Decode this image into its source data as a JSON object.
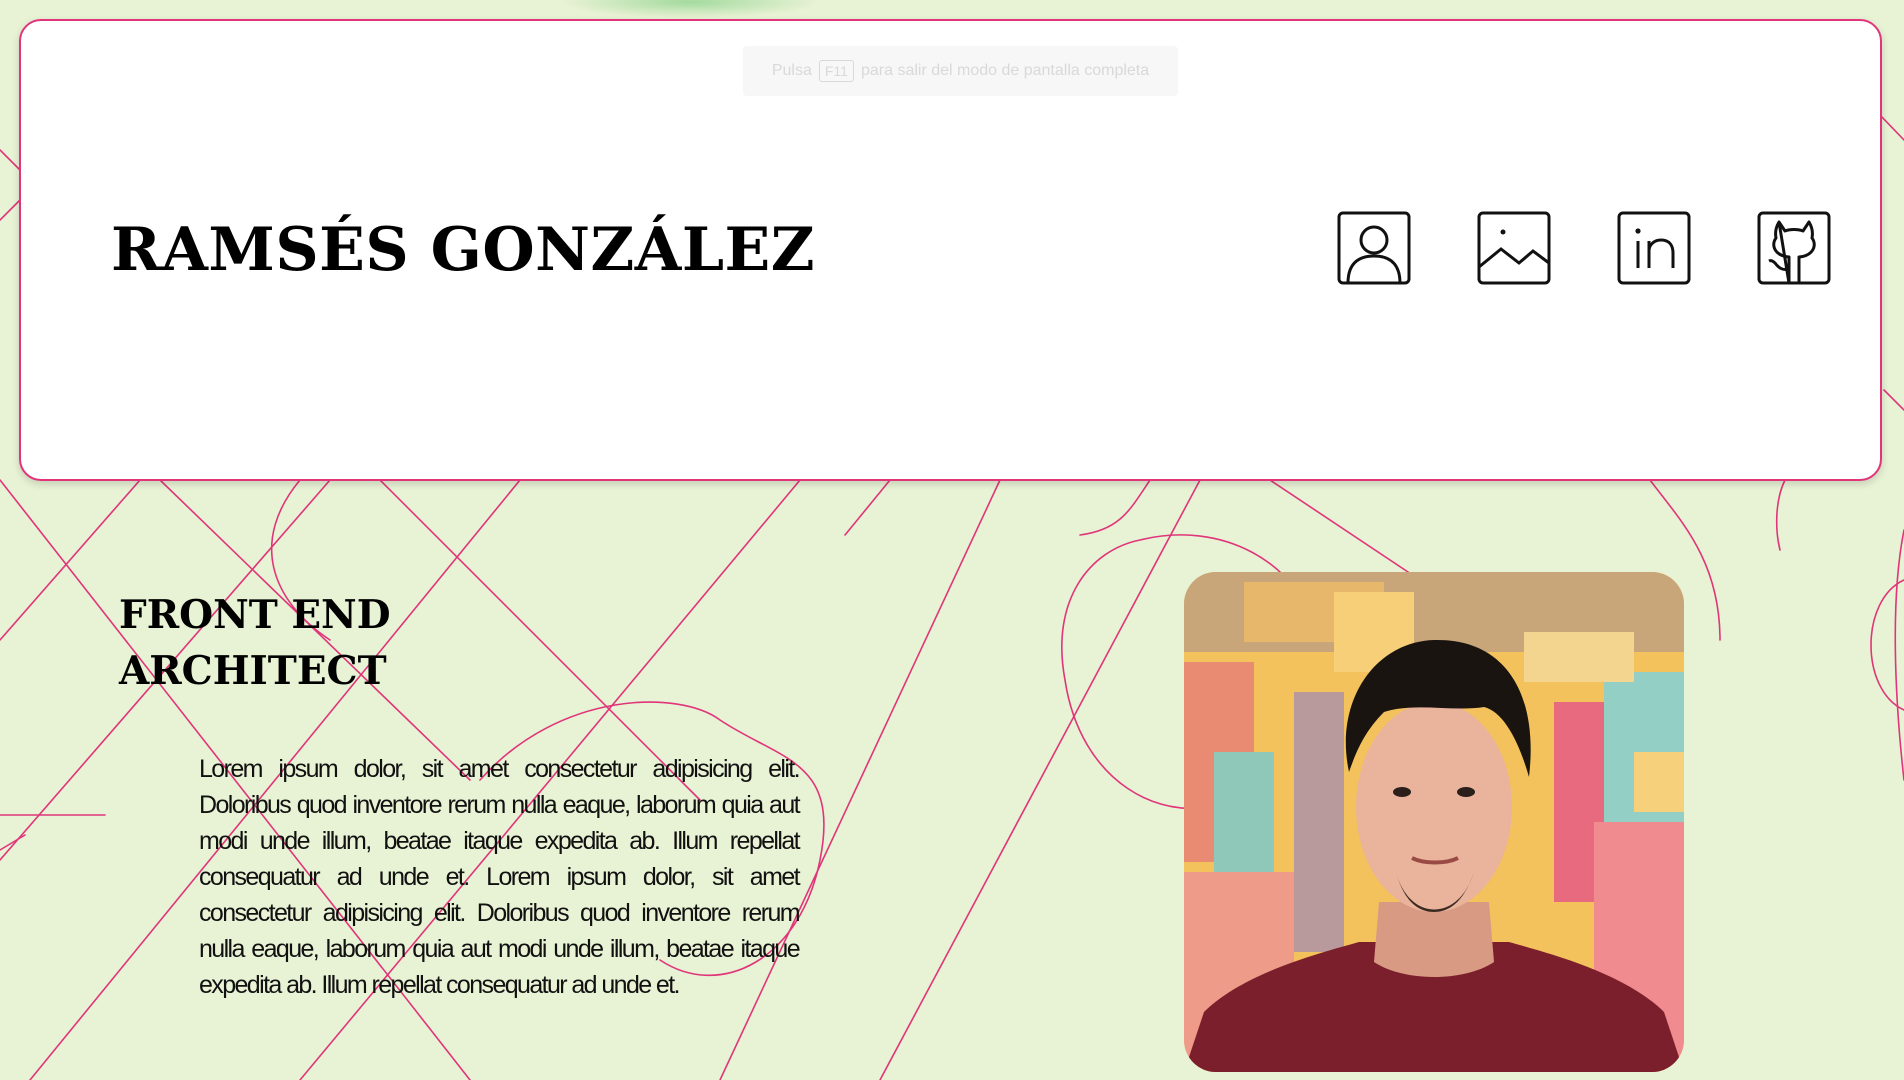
{
  "fullscreen_toast": {
    "prefix": "Pulsa",
    "key": "F11",
    "suffix": "para salir del modo de pantalla completa"
  },
  "header": {
    "title": "RAMSÉS GONZÁLEZ",
    "nav": [
      {
        "icon": "user-icon",
        "label": "About"
      },
      {
        "icon": "image-icon",
        "label": "Gallery"
      },
      {
        "icon": "linkedin-icon",
        "label": "LinkedIn"
      },
      {
        "icon": "github-icon",
        "label": "GitHub"
      }
    ]
  },
  "hero": {
    "heading_line1": "FRONT END",
    "heading_line2": "ARCHITECT",
    "body": "Lorem ipsum dolor, sit amet consectetur adipisicing elit. Doloribus quod inventore rerum nulla eaque, laborum quia aut modi unde illum, beatae itaque expedita ab. Illum repellat consequatur ad unde et. Lorem ipsum dolor, sit amet consectetur adipisicing elit. Doloribus quod inventore rerum nulla eaque, laborum quia aut modi unde illum, beatae itaque expedita ab. Illum repellat consequatur ad unde et."
  },
  "colors": {
    "background": "#e8f2d4",
    "accent": "#e0357a",
    "card": "#ffffff",
    "text": "#000000"
  }
}
